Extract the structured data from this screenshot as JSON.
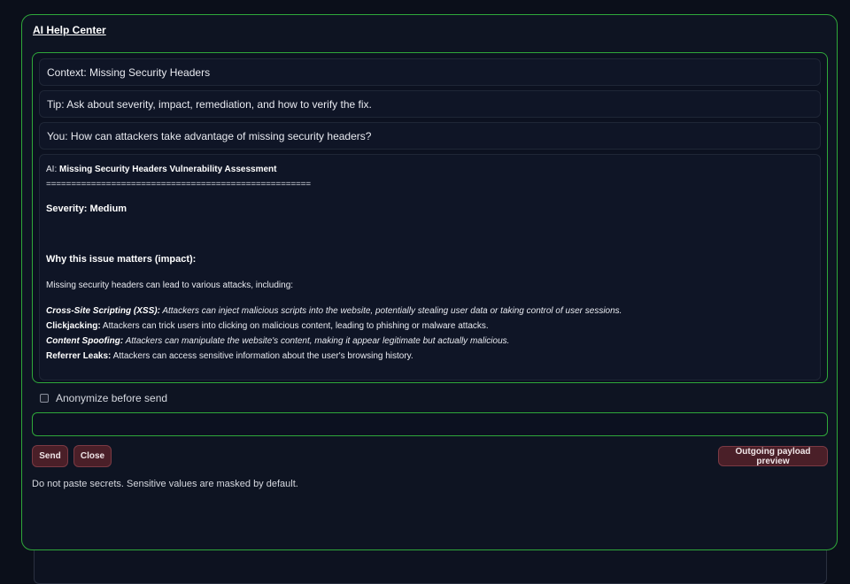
{
  "dialog": {
    "title": "AI Help Center"
  },
  "chat": {
    "context": "Context: Missing Security Headers",
    "tip": "Tip: Ask about severity, impact, remediation, and how to verify the fix.",
    "user_message": "You: How can attackers take advantage of missing security headers?",
    "ai": {
      "prefix": "AI: ",
      "heading": "Missing Security Headers Vulnerability Assessment",
      "separator": "=====================================================",
      "severity": "Severity: Medium",
      "why_heading": "Why this issue matters (impact):",
      "intro": "Missing security headers can lead to various attacks, including:",
      "items": [
        {
          "term": "Cross-Site Scripting (XSS):",
          "desc": " Attackers can inject malicious scripts into the website, potentially stealing user data or taking control of user sessions.",
          "italic": true
        },
        {
          "term": "Clickjacking:",
          "desc": " Attackers can trick users into clicking on malicious content, leading to phishing or malware attacks.",
          "italic": false
        },
        {
          "term": "Content Spoofing:",
          "desc": " Attackers can manipulate the website's content, making it appear legitimate but actually malicious.",
          "italic": true
        },
        {
          "term": "Referrer Leaks:",
          "desc": " Attackers can access sensitive information about the user's browsing history.",
          "italic": false
        }
      ]
    }
  },
  "anonymize": {
    "label": "Anonymize before send",
    "checked": false
  },
  "input": {
    "value": "",
    "placeholder": ""
  },
  "buttons": {
    "send": "Send",
    "close": "Close",
    "preview": "Outgoing payload preview"
  },
  "footer_note": "Do not paste secrets. Sensitive values are masked by default.",
  "colors": {
    "accent_border": "#2fa83a",
    "button_bg": "#4a1f28",
    "background": "#0b0f1a"
  }
}
